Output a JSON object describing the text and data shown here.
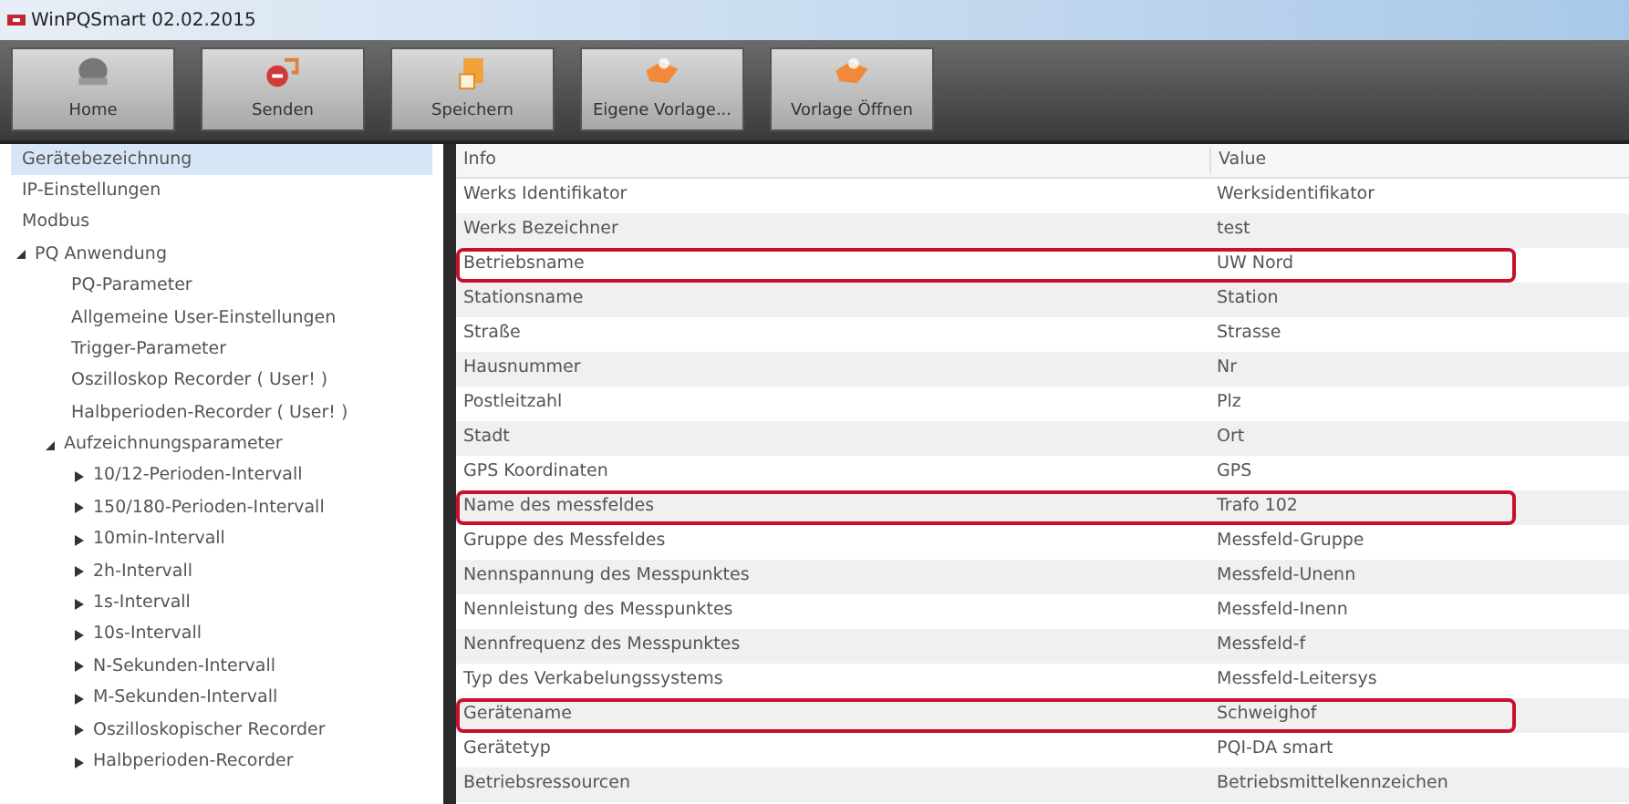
{
  "window": {
    "title": "WinPQSmart 02.02.2015"
  },
  "toolbar": [
    {
      "label": "Home",
      "kind": "dome"
    },
    {
      "label": "Senden",
      "kind": "send"
    },
    {
      "label": "Speichern",
      "kind": "save"
    },
    {
      "label": "Eigene Vorlage...",
      "kind": "template"
    },
    {
      "label": "Vorlage Öffnen",
      "kind": "template"
    }
  ],
  "sidebar": {
    "items": [
      {
        "label": "Gerätebezeichnung",
        "selected": true
      },
      {
        "label": "IP-Einstellungen",
        "selected": false
      },
      {
        "label": "Modbus",
        "selected": false
      },
      {
        "label": "PQ Anwendung",
        "selected": false,
        "expanded": true,
        "children": [
          {
            "label": "PQ-Parameter",
            "selected": false
          },
          {
            "label": "Allgemeine User-Einstellungen",
            "selected": false
          },
          {
            "label": "Trigger-Parameter",
            "selected": false
          },
          {
            "label": "Oszilloskop Recorder ( User! )",
            "selected": false
          },
          {
            "label": "Halbperioden-Recorder ( User! )",
            "selected": false
          },
          {
            "label": "Aufzeichnungsparameter",
            "selected": false,
            "expanded": true,
            "children": [
              {
                "label": "10/12-Perioden-Intervall",
                "selected": false,
                "expanded": false
              },
              {
                "label": "150/180-Perioden-Intervall",
                "selected": false,
                "expanded": false
              },
              {
                "label": "10min-Intervall",
                "selected": false,
                "expanded": false
              },
              {
                "label": "2h-Intervall",
                "selected": false,
                "expanded": false
              },
              {
                "label": "1s-Intervall",
                "selected": false,
                "expanded": false
              },
              {
                "label": "10s-Intervall",
                "selected": false,
                "expanded": false
              },
              {
                "label": "N-Sekunden-Intervall",
                "selected": false,
                "expanded": false
              },
              {
                "label": "M-Sekunden-Intervall",
                "selected": false,
                "expanded": false
              },
              {
                "label": "Oszilloskopischer Recorder",
                "selected": false,
                "expanded": false
              },
              {
                "label": "Halbperioden-Recorder",
                "selected": false,
                "expanded": false
              }
            ]
          }
        ]
      }
    ]
  },
  "table": {
    "columns": [
      "Info",
      "Value"
    ],
    "rows": [
      {
        "cells": [
          "Werks Identifikator",
          "Werksidentifikator"
        ],
        "highlighted": false
      },
      {
        "cells": [
          "Werks Bezeichner",
          "test"
        ],
        "highlighted": false
      },
      {
        "cells": [
          "Betriebsname",
          "UW Nord"
        ],
        "highlighted": true
      },
      {
        "cells": [
          "Stationsname",
          "Station"
        ],
        "highlighted": false
      },
      {
        "cells": [
          "Straße",
          "Strasse"
        ],
        "highlighted": false
      },
      {
        "cells": [
          "Hausnummer",
          "Nr"
        ],
        "highlighted": false
      },
      {
        "cells": [
          "Postleitzahl",
          "Plz"
        ],
        "highlighted": false
      },
      {
        "cells": [
          "Stadt",
          "Ort"
        ],
        "highlighted": false
      },
      {
        "cells": [
          "GPS Koordinaten",
          "GPS"
        ],
        "highlighted": false
      },
      {
        "cells": [
          "Name des messfeldes",
          "Trafo 102"
        ],
        "highlighted": true
      },
      {
        "cells": [
          "Gruppe des Messfeldes",
          "Messfeld-Gruppe"
        ],
        "highlighted": false
      },
      {
        "cells": [
          "Nennspannung des Messpunktes",
          "Messfeld-Unenn"
        ],
        "highlighted": false
      },
      {
        "cells": [
          "Nennleistung des Messpunktes",
          "Messfeld-Inenn"
        ],
        "highlighted": false
      },
      {
        "cells": [
          "Nennfrequenz des Messpunktes",
          "Messfeld-f"
        ],
        "highlighted": false
      },
      {
        "cells": [
          "Typ des Verkabelungssystems",
          "Messfeld-Leitersys"
        ],
        "highlighted": false
      },
      {
        "cells": [
          "Gerätename",
          "Schweighof"
        ],
        "highlighted": true
      },
      {
        "cells": [
          "Gerätetyp",
          "PQI-DA smart"
        ],
        "highlighted": false
      },
      {
        "cells": [
          "Betriebsressourcen",
          "Betriebsmittelkennzeichen"
        ],
        "highlighted": false
      }
    ]
  }
}
